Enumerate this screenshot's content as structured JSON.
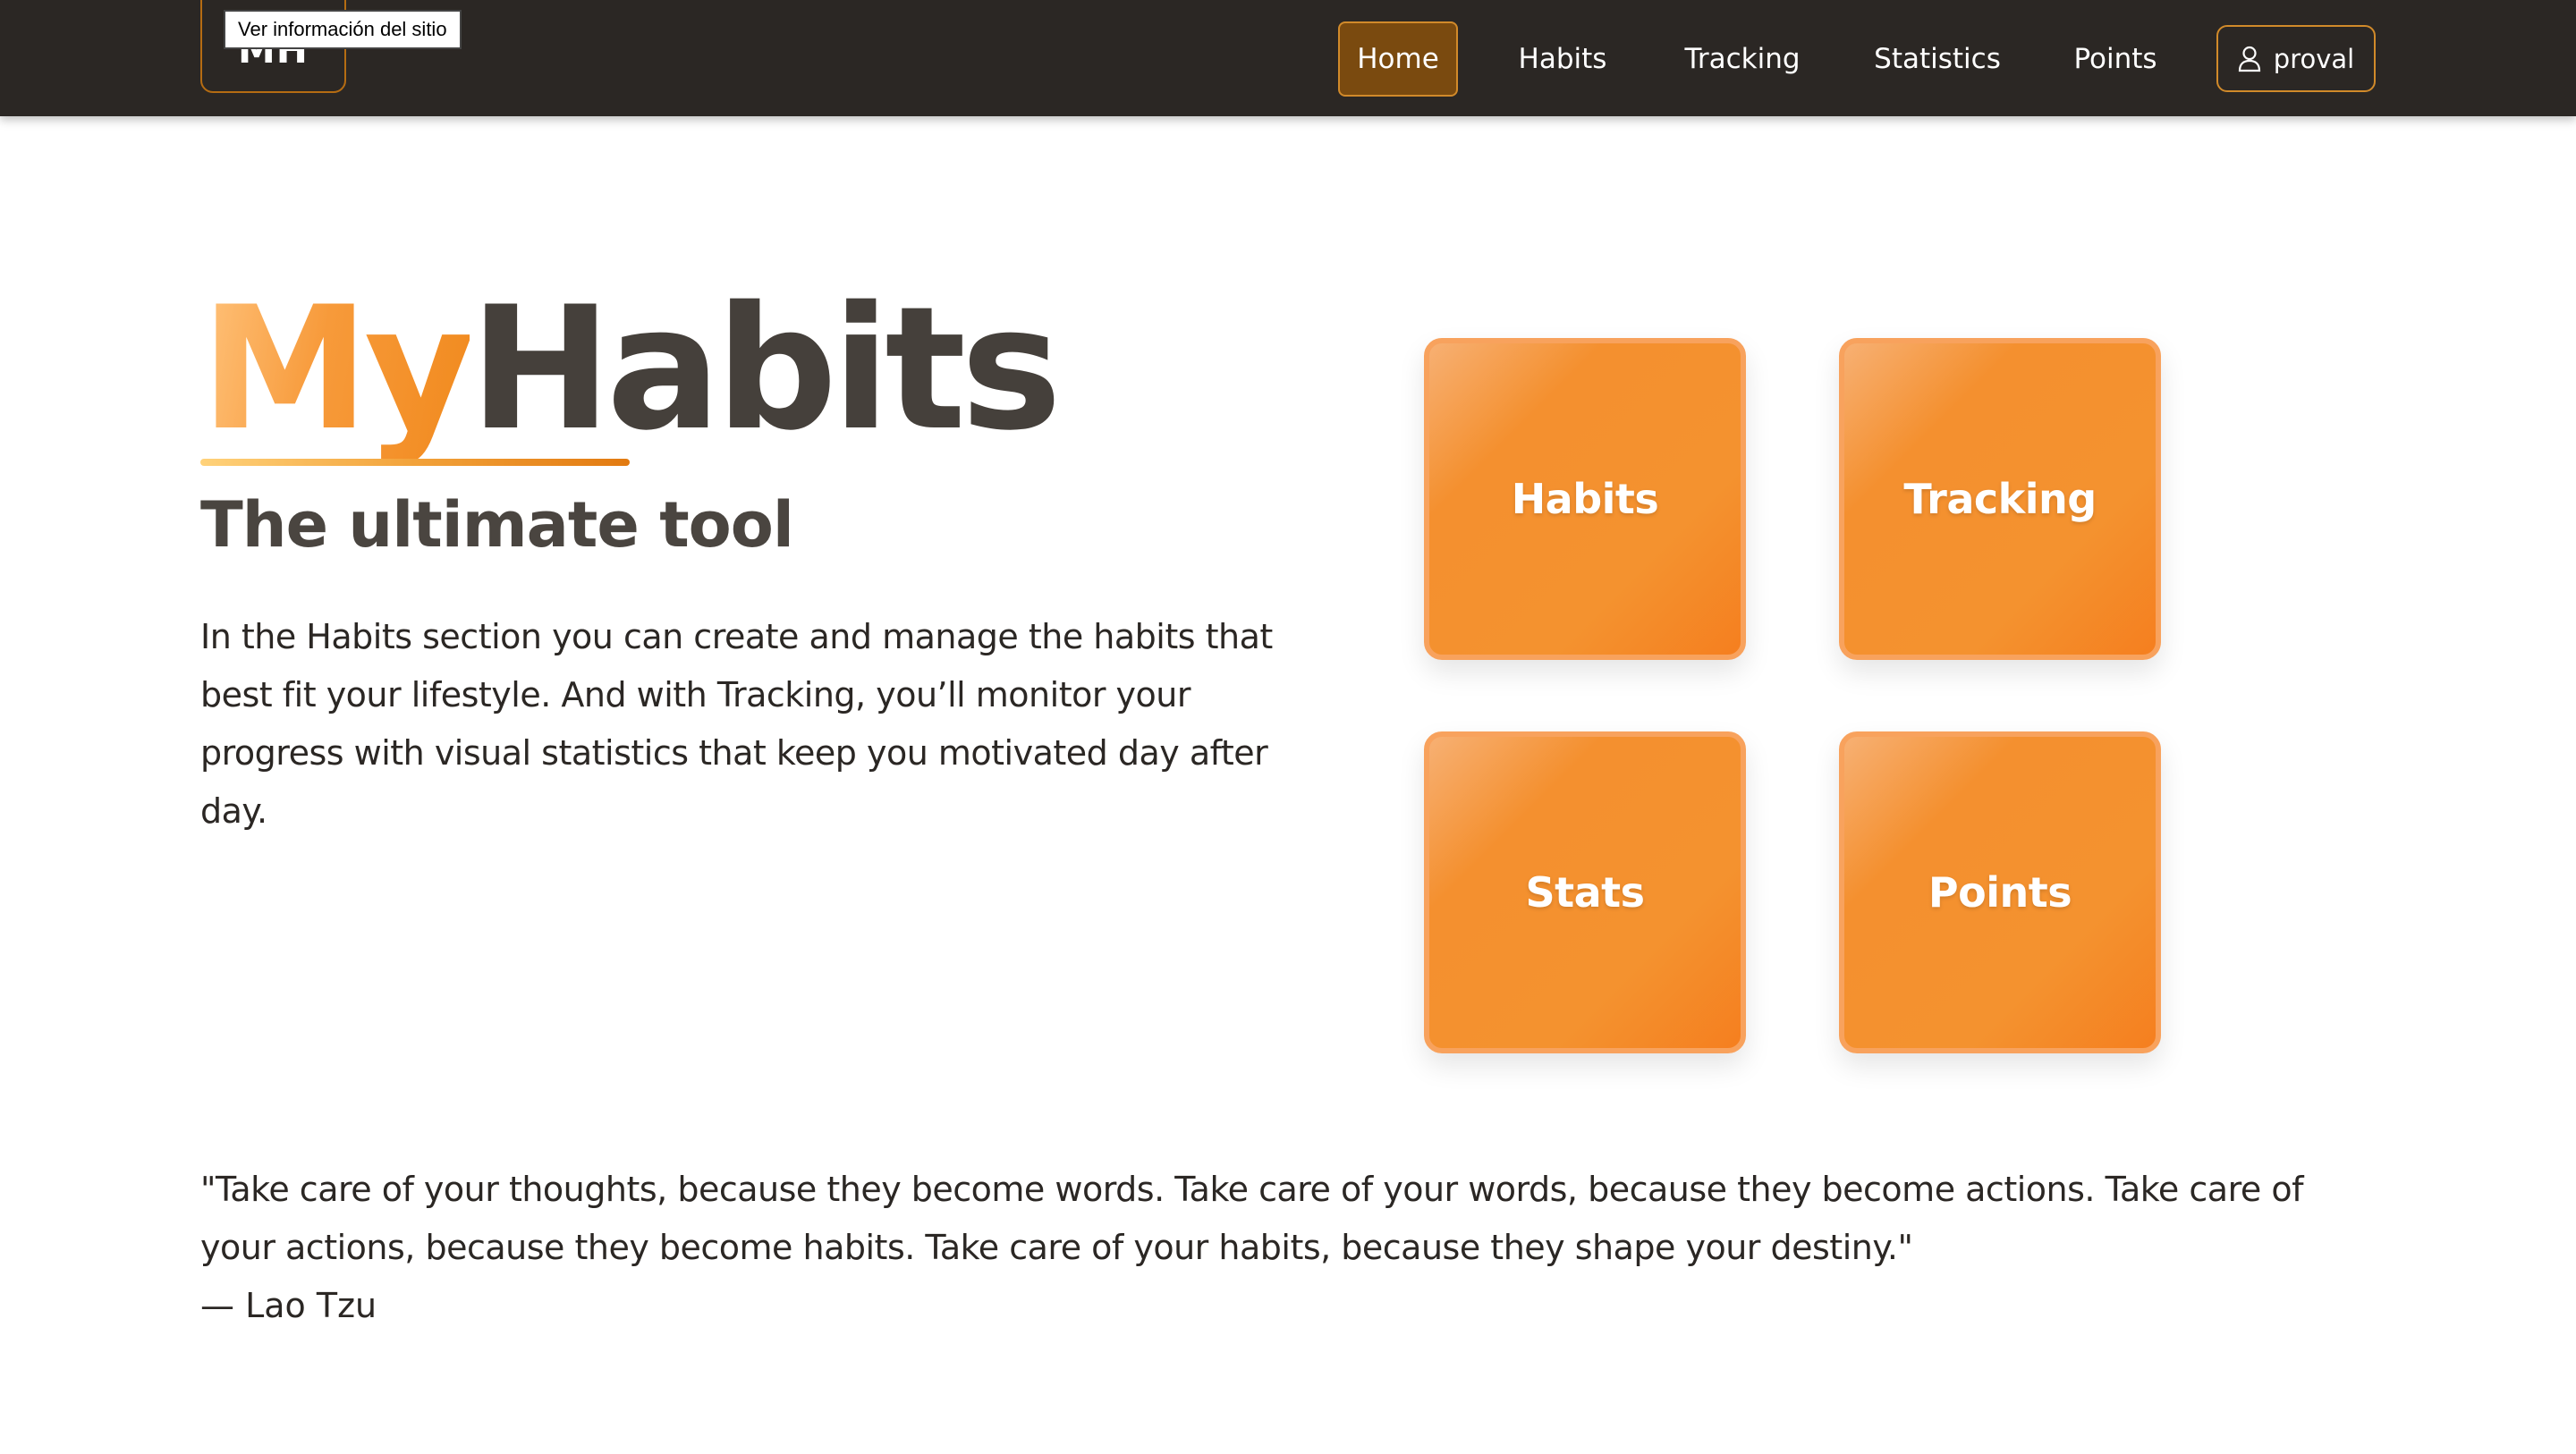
{
  "navbar": {
    "logo_text": "MH",
    "tooltip": "Ver información del sitio",
    "links": [
      {
        "label": "Home",
        "active": true
      },
      {
        "label": "Habits",
        "active": false
      },
      {
        "label": "Tracking",
        "active": false
      },
      {
        "label": "Statistics",
        "active": false
      },
      {
        "label": "Points",
        "active": false
      }
    ],
    "user": {
      "icon": "user-icon",
      "label": "proval"
    }
  },
  "hero": {
    "brand_part1": "My",
    "brand_part2": "Habits",
    "subtitle": "The ultimate tool",
    "description": "In the Habits section you can create and manage the habits that best fit your lifestyle. And with Tracking, you’ll monitor your progress with visual statistics that keep you motivated day after day."
  },
  "tiles": [
    {
      "label": "Habits"
    },
    {
      "label": "Tracking"
    },
    {
      "label": "Stats"
    },
    {
      "label": "Points"
    }
  ],
  "quote": {
    "text": "\"Take care of your thoughts, because they become words. Take care of your words, because they become actions. Take care of your actions, because they become habits. Take care of your habits, because they shape your destiny.\"",
    "author": "— Lao Tzu"
  },
  "colors": {
    "navbar_bg": "#2b2724",
    "accent_orange": "#f4902f",
    "active_nav_bg": "#7a4a0f",
    "nav_border": "#d18a2a",
    "brand_dark": "#45403b"
  }
}
